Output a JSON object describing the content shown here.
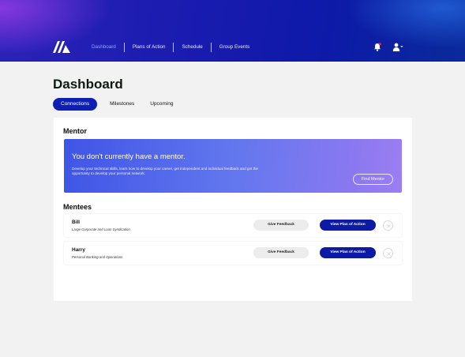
{
  "nav": {
    "items": [
      {
        "label": "Dashboard",
        "active": true
      },
      {
        "label": "Plans of Action",
        "active": false
      },
      {
        "label": "Schedule",
        "active": false
      },
      {
        "label": "Group Events",
        "active": false
      }
    ],
    "icons": [
      "logo-icon",
      "bell-icon",
      "user-icon",
      "chevron-down-icon"
    ],
    "notification_dot_color": "#e0245e"
  },
  "page": {
    "title": "Dashboard"
  },
  "tabs": [
    {
      "label": "Connections",
      "active": true
    },
    {
      "label": "Milestones",
      "active": false
    },
    {
      "label": "Upcoming",
      "active": false
    }
  ],
  "mentor": {
    "section_title": "Mentor",
    "banner_title": "You don't currently have a mentor.",
    "banner_text": "Develop your technical skills, learn how to develop your career, get independent and individual feedback and get the opportunity to develop your personal network.",
    "find_button": "Find Mentor"
  },
  "mentees": {
    "section_title": "Mentees",
    "items": [
      {
        "name": "Bill",
        "subtitle": "Large Corporate and Loan Syndication",
        "feedback_label": "Give Feedback",
        "plan_label": "View Plan of Action"
      },
      {
        "name": "Harry",
        "subtitle": "Personal Banking and Operations",
        "feedback_label": "Give Feedback",
        "plan_label": "View Plan of Action"
      }
    ]
  },
  "colors": {
    "accent": "#0e1fb5",
    "plan_button": "#0c1aa6",
    "page_background": "#f2f2f2"
  }
}
